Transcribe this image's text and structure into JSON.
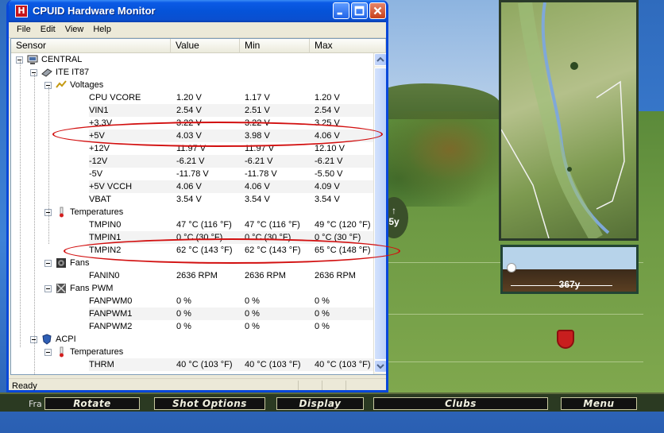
{
  "window": {
    "title": "CPUID Hardware Monitor",
    "app_icon_letter": "H"
  },
  "menu": [
    "File",
    "Edit",
    "View",
    "Help"
  ],
  "columns": [
    "Sensor",
    "Value",
    "Min",
    "Max"
  ],
  "rows": [
    {
      "level": 0,
      "kind": "node",
      "icon": "computer-icon",
      "name": "CENTRAL"
    },
    {
      "level": 1,
      "kind": "node",
      "icon": "chip-icon",
      "name": "ITE IT87"
    },
    {
      "level": 2,
      "kind": "node",
      "icon": "voltage-icon",
      "name": "Voltages"
    },
    {
      "level": 3,
      "kind": "leaf",
      "name": "CPU VCORE",
      "value": "1.20 V",
      "min": "1.17 V",
      "max": "1.20 V"
    },
    {
      "level": 3,
      "kind": "leaf",
      "name": "VIN1",
      "value": "2.54 V",
      "min": "2.51 V",
      "max": "2.54 V"
    },
    {
      "level": 3,
      "kind": "leaf",
      "name": "+3.3V",
      "value": "3.22 V",
      "min": "3.22 V",
      "max": "3.25 V"
    },
    {
      "level": 3,
      "kind": "leaf",
      "name": "+5V",
      "value": "4.03 V",
      "min": "3.98 V",
      "max": "4.06 V"
    },
    {
      "level": 3,
      "kind": "leaf",
      "name": "+12V",
      "value": "11.97 V",
      "min": "11.97 V",
      "max": "12.10 V"
    },
    {
      "level": 3,
      "kind": "leaf",
      "name": "-12V",
      "value": "-6.21 V",
      "min": "-6.21 V",
      "max": "-6.21 V"
    },
    {
      "level": 3,
      "kind": "leaf",
      "name": "-5V",
      "value": "-11.78 V",
      "min": "-11.78 V",
      "max": "-5.50 V"
    },
    {
      "level": 3,
      "kind": "leaf",
      "name": "+5V VCCH",
      "value": "4.06 V",
      "min": "4.06 V",
      "max": "4.09 V"
    },
    {
      "level": 3,
      "kind": "leaf",
      "name": "VBAT",
      "value": "3.54 V",
      "min": "3.54 V",
      "max": "3.54 V"
    },
    {
      "level": 2,
      "kind": "node",
      "icon": "thermometer-icon",
      "name": "Temperatures"
    },
    {
      "level": 3,
      "kind": "leaf",
      "name": "TMPIN0",
      "value": "47 °C  (116 °F)",
      "min": "47 °C  (116 °F)",
      "max": "49 °C  (120 °F)"
    },
    {
      "level": 3,
      "kind": "leaf",
      "name": "TMPIN1",
      "value": "0 °C  (30 °F)",
      "min": "0 °C  (30 °F)",
      "max": "0 °C  (30 °F)"
    },
    {
      "level": 3,
      "kind": "leaf",
      "name": "TMPIN2",
      "value": "62 °C  (143 °F)",
      "min": "62 °C  (143 °F)",
      "max": "65 °C  (148 °F)"
    },
    {
      "level": 2,
      "kind": "node",
      "icon": "fan-icon",
      "name": "Fans"
    },
    {
      "level": 3,
      "kind": "leaf",
      "name": "FANIN0",
      "value": "2636 RPM",
      "min": "2636 RPM",
      "max": "2636 RPM"
    },
    {
      "level": 2,
      "kind": "node",
      "icon": "fan-pwm-icon",
      "name": "Fans PWM"
    },
    {
      "level": 3,
      "kind": "leaf",
      "name": "FANPWM0",
      "value": "0 %",
      "min": "0 %",
      "max": "0 %"
    },
    {
      "level": 3,
      "kind": "leaf",
      "name": "FANPWM1",
      "value": "0 %",
      "min": "0 %",
      "max": "0 %"
    },
    {
      "level": 3,
      "kind": "leaf",
      "name": "FANPWM2",
      "value": "0 %",
      "min": "0 %",
      "max": "0 %"
    },
    {
      "level": 1,
      "kind": "node",
      "icon": "acpi-icon",
      "name": "ACPI"
    },
    {
      "level": 2,
      "kind": "node",
      "icon": "thermometer-icon",
      "name": "Temperatures"
    },
    {
      "level": 3,
      "kind": "leaf",
      "name": "THRM",
      "value": "40 °C  (103 °F)",
      "min": "40 °C  (103 °F)",
      "max": "40 °C  (103 °F)"
    }
  ],
  "status": "Ready",
  "game": {
    "buttons": [
      "Rotate",
      "Shot Options",
      "Display",
      "Clubs",
      "Menu"
    ],
    "left_label": "Fra",
    "distance": "367y",
    "badge_text": "5y",
    "colors": {
      "highlight_ring": "#d21010",
      "titlebar": "#0553d8"
    }
  }
}
